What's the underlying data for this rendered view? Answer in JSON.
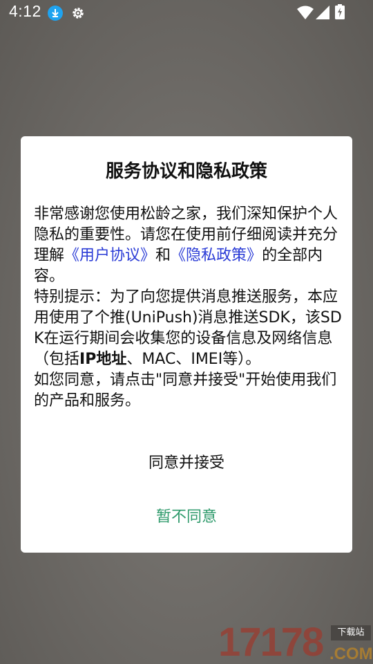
{
  "status_bar": {
    "time": "4:12",
    "icons": [
      "download-icon",
      "gear-icon",
      "wifi-icon",
      "signal-icon",
      "battery-icon"
    ]
  },
  "dialog": {
    "title": "服务协议和隐私政策",
    "body": {
      "p1_a": "非常感谢您使用松龄之家，我们深知保护个人隐私的重要性。请您在使用前仔细阅读并充分理解",
      "link_user_agreement": "《用户协议》",
      "p1_b": "和",
      "link_privacy_policy": "《隐私政策》",
      "p1_c": "的全部内容。",
      "p2_a": "特别提示：为了向您提供消息推送服务，本应用使用了个推(UniPush)消息推送SDK，该SDK在运行期间会收集您的设备信息及网络信息（包括",
      "p2_bold": "IP地址",
      "p2_b": "、MAC、IMEI等）。",
      "p3": "如您同意，请点击\"同意并接受\"开始使用我们的产品和服务。"
    },
    "agree_label": "同意并接受",
    "disagree_label": "暂不同意"
  },
  "watermark": {
    "number": "17178",
    "tag": "下载站",
    "domain": ".COM"
  },
  "colors": {
    "link": "#2a3bd6",
    "disagree": "#2e9a6b",
    "overlay": "#6f6c68"
  }
}
